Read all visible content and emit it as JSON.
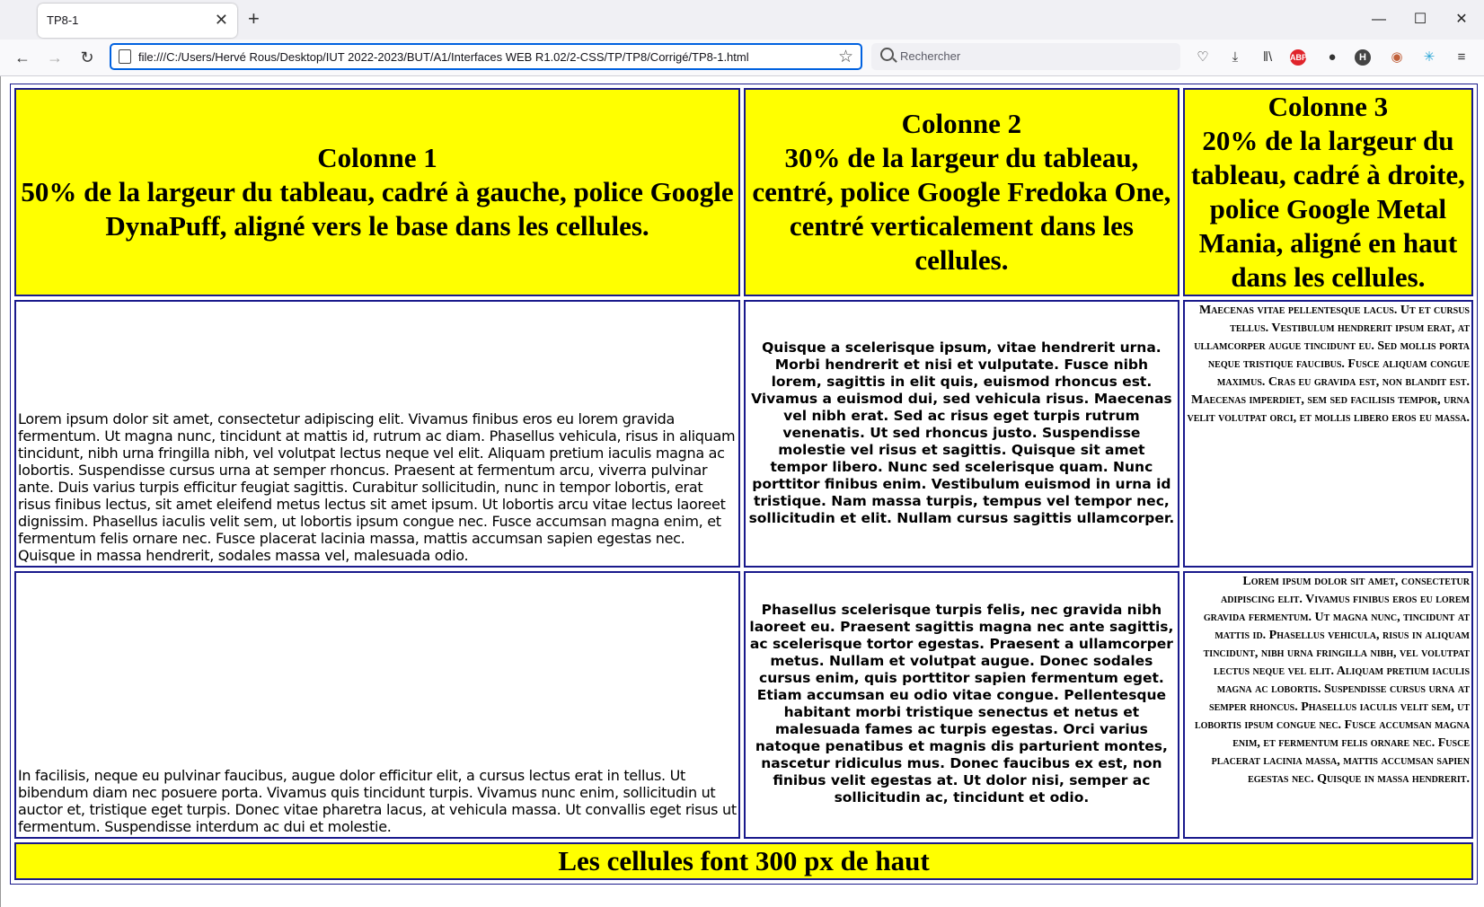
{
  "browser": {
    "tab_title": "TP8-1",
    "url": "file:///C:/Users/Hervé Rous/Desktop/IUT 2022-2023/BUT/A1/Interfaces WEB R1.02/2-CSS/TP/TP8/Corrigé/TP8-1.html",
    "search_placeholder": "Rechercher",
    "icons": [
      "back-icon",
      "forward-icon",
      "reload-icon",
      "page-icon",
      "bookmark-star-icon",
      "search-icon",
      "pocket-icon",
      "download-icon",
      "library-icon",
      "adblock-icon",
      "extension-icon",
      "h-extension-icon",
      "cookie-icon",
      "sync-icon",
      "menu-icon"
    ]
  },
  "table": {
    "headers": [
      {
        "title": "Colonne 1",
        "desc": "50% de la largeur du tableau, cadré à gauche, police Google DynaPuff, aligné vers le base dans les cellules."
      },
      {
        "title": "Colonne 2",
        "desc": "30% de la largeur du tableau, centré, police Google Fredoka One, centré verticalement dans les cellules."
      },
      {
        "title": "Colonne 3",
        "desc": "20% de la largeur du tableau, cadré à droite, police Google Metal Mania, aligné en haut dans les cellules."
      }
    ],
    "rows": [
      [
        "Lorem ipsum dolor sit amet, consectetur adipiscing elit. Vivamus finibus eros eu lorem gravida fermentum. Ut magna nunc, tincidunt at mattis id, rutrum ac diam. Phasellus vehicula, risus in aliquam tincidunt, nibh urna fringilla nibh, vel volutpat lectus neque vel elit. Aliquam pretium iaculis magna ac lobortis. Suspendisse cursus urna at semper rhoncus. Praesent at fermentum arcu, viverra pulvinar ante. Duis varius turpis efficitur feugiat sagittis. Curabitur sollicitudin, nunc in tempor lobortis, erat risus finibus lectus, sit amet eleifend metus lectus sit amet ipsum. Ut lobortis arcu vitae lectus laoreet dignissim. Phasellus iaculis velit sem, ut lobortis ipsum congue nec. Fusce accumsan magna enim, et fermentum felis ornare nec. Fusce placerat lacinia massa, mattis accumsan sapien egestas nec. Quisque in massa hendrerit, sodales massa vel, malesuada odio.",
        "Quisque a scelerisque ipsum, vitae hendrerit urna. Morbi hendrerit et nisi et vulputate. Fusce nibh lorem, sagittis in elit quis, euismod rhoncus est. Vivamus a euismod dui, sed vehicula risus. Maecenas vel nibh erat. Sed ac risus eget turpis rutrum venenatis. Ut sed rhoncus justo. Suspendisse molestie vel risus et sagittis. Quisque sit amet tempor libero. Nunc sed scelerisque quam. Nunc porttitor finibus enim. Vestibulum euismod in urna id tristique. Nam massa turpis, tempus vel tempor nec, sollicitudin et elit. Nullam cursus sagittis ullamcorper.",
        "Maecenas vitae pellentesque lacus. Ut et cursus tellus. Vestibulum hendrerit ipsum erat, at ullamcorper augue tincidunt eu. Sed mollis porta neque tristique faucibus. Fusce aliquam congue maximus. Cras eu gravida est, non blandit est. Maecenas imperdiet, sem sed facilisis tempor, urna velit volutpat orci, et mollis libero eros eu massa."
      ],
      [
        "In facilisis, neque eu pulvinar faucibus, augue dolor efficitur elit, a cursus lectus erat in tellus. Ut bibendum diam nec posuere porta. Vivamus quis tincidunt turpis. Vivamus nunc enim, sollicitudin ut auctor et, tristique eget turpis. Donec vitae pharetra lacus, at vehicula massa. Ut convallis eget risus ut fermentum. Suspendisse interdum ac dui et molestie.",
        "Phasellus scelerisque turpis felis, nec gravida nibh laoreet eu. Praesent sagittis magna nec ante sagittis, ac scelerisque tortor egestas. Praesent a ullamcorper metus. Nullam et volutpat augue. Donec sodales cursus enim, quis porttitor sapien fermentum eget. Etiam accumsan eu odio vitae congue. Pellentesque habitant morbi tristique senectus et netus et malesuada fames ac turpis egestas. Orci varius natoque penatibus et magnis dis parturient montes, nascetur ridiculus mus. Donec faucibus ex est, non finibus velit egestas at. Ut dolor nisi, semper ac sollicitudin ac, tincidunt et odio.",
        "Lorem ipsum dolor sit amet, consectetur adipiscing elit. Vivamus finibus eros eu lorem gravida fermentum. Ut magna nunc, tincidunt at mattis id. Phasellus vehicula, risus in aliquam tincidunt, nibh urna fringilla nibh, vel volutpat lectus neque vel elit. Aliquam pretium iaculis magna ac lobortis. Suspendisse cursus urna at semper rhoncus. Phasellus iaculis velit sem, ut lobortis ipsum congue nec. Fusce accumsan magna enim, et fermentum felis ornare nec. Fusce placerat lacinia massa, mattis accumsan sapien egestas nec. Quisque in massa hendrerit."
      ]
    ],
    "footer": "Les cellules font 300 px de haut"
  },
  "colors": {
    "header_bg": "#ffff00",
    "border": "#1a1a8c",
    "url_focus": "#0061e0"
  }
}
